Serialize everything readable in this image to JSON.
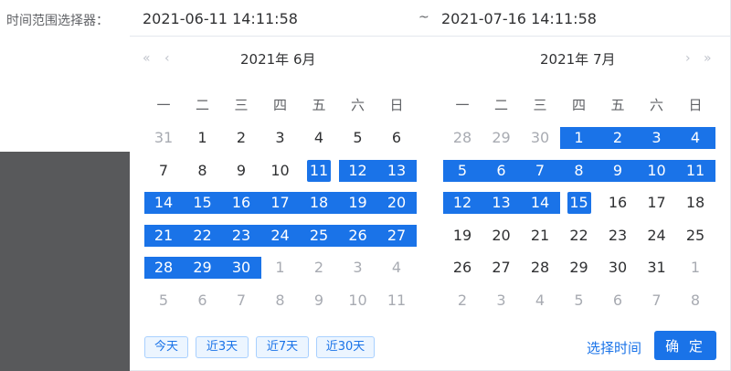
{
  "form": {
    "label": "时间范围选择器："
  },
  "range": {
    "start": "2021-06-11 14:11:58",
    "separator": "~",
    "end": "2021-07-16 14:11:58"
  },
  "left": {
    "title": "2021年 6月",
    "nav": {
      "prev_year": "«",
      "prev_month": "‹"
    },
    "weekdays": [
      "一",
      "二",
      "三",
      "四",
      "五",
      "六",
      "日"
    ],
    "days": [
      31,
      1,
      2,
      3,
      4,
      5,
      6,
      7,
      8,
      9,
      10,
      11,
      12,
      13,
      14,
      15,
      16,
      17,
      18,
      19,
      20,
      21,
      22,
      23,
      24,
      25,
      26,
      27,
      28,
      29,
      30,
      1,
      2,
      3,
      4,
      5,
      6,
      7,
      8,
      9,
      10,
      11
    ],
    "current_month_index_range": [
      1,
      30
    ],
    "range_index": [
      11,
      30
    ],
    "endpoint_index": 11
  },
  "right": {
    "title": "2021年 7月",
    "nav": {
      "next_month": "›",
      "next_year": "»"
    },
    "weekdays": [
      "一",
      "二",
      "三",
      "四",
      "五",
      "六",
      "日"
    ],
    "days": [
      28,
      29,
      30,
      1,
      2,
      3,
      4,
      5,
      6,
      7,
      8,
      9,
      10,
      11,
      12,
      13,
      14,
      15,
      16,
      17,
      18,
      19,
      20,
      21,
      22,
      23,
      24,
      25,
      26,
      27,
      28,
      29,
      30,
      31,
      1,
      2,
      3,
      4,
      5,
      6,
      7,
      8
    ],
    "current_month_index_range": [
      3,
      33
    ],
    "range_index": [
      3,
      17
    ],
    "endpoint_index": 17
  },
  "footer": {
    "shortcuts": [
      "今天",
      "近3天",
      "近7天",
      "近30天"
    ],
    "select_time": "选择时间",
    "confirm": "确 定"
  },
  "colors": {
    "accent": "#1a73e8",
    "backdrop": "#58595b"
  }
}
